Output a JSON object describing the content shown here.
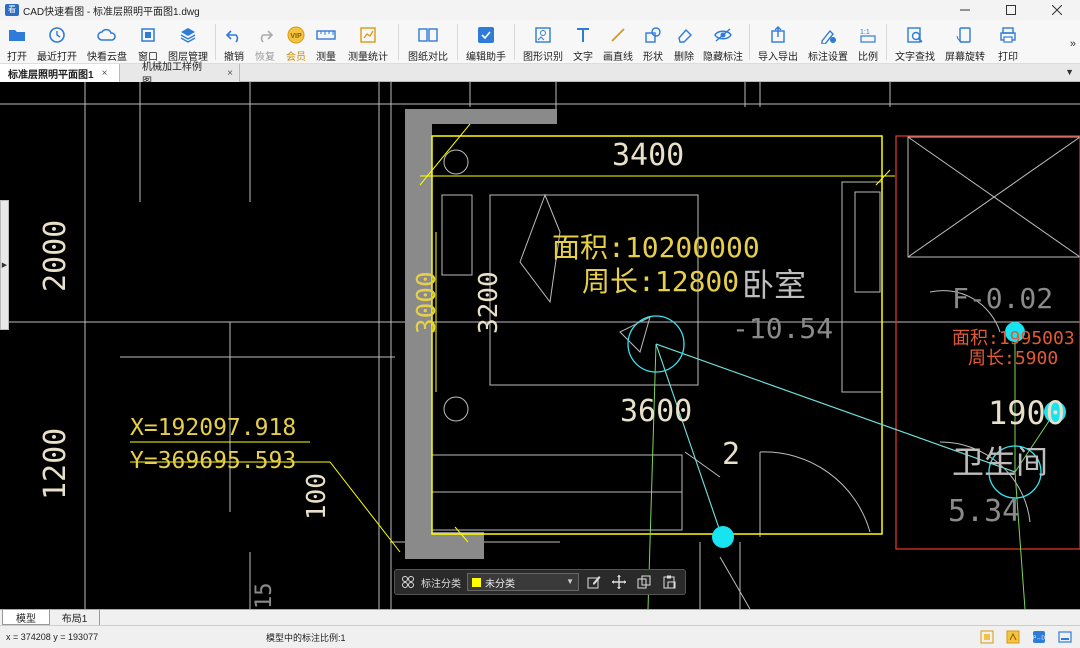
{
  "window": {
    "title": "CAD快速看图 - 标准层照明平面图1.dwg",
    "app_icon_text": "看",
    "controls": [
      "minimize-icon",
      "maximize-icon",
      "close-icon"
    ]
  },
  "toolbar": {
    "items": [
      {
        "id": "open",
        "label": "打开",
        "icon": "folder-icon"
      },
      {
        "id": "recent",
        "label": "最近打开",
        "icon": "clock-icon"
      },
      {
        "id": "cloud",
        "label": "快看云盘",
        "icon": "cloud-icon"
      },
      {
        "id": "window",
        "label": "窗口",
        "icon": "window-icon"
      },
      {
        "id": "layers",
        "label": "图层管理",
        "icon": "layers-icon"
      },
      {
        "id": "undo",
        "label": "撤销",
        "icon": "undo-icon"
      },
      {
        "id": "redo",
        "label": "恢复",
        "icon": "redo-icon",
        "disabled": true
      },
      {
        "id": "vip",
        "label": "会员",
        "icon": "vip-icon"
      },
      {
        "id": "measure",
        "label": "测量",
        "icon": "ruler-icon"
      },
      {
        "id": "measure-stats",
        "label": "测量统计",
        "icon": "stats-icon"
      },
      {
        "id": "compare",
        "label": "图纸对比",
        "icon": "compare-icon"
      },
      {
        "id": "edit-helper",
        "label": "编辑助手",
        "icon": "edit-helper-icon"
      },
      {
        "id": "shape-recog",
        "label": "图形识别",
        "icon": "shape-recog-icon"
      },
      {
        "id": "text",
        "label": "文字",
        "icon": "text-icon"
      },
      {
        "id": "line",
        "label": "画直线",
        "icon": "line-icon"
      },
      {
        "id": "shape",
        "label": "形状",
        "icon": "shape-icon"
      },
      {
        "id": "delete",
        "label": "删除",
        "icon": "eraser-icon"
      },
      {
        "id": "hide-annot",
        "label": "隐藏标注",
        "icon": "eye-hide-icon"
      },
      {
        "id": "import-export",
        "label": "导入导出",
        "icon": "export-icon"
      },
      {
        "id": "annot-settings",
        "label": "标注设置",
        "icon": "annot-settings-icon"
      },
      {
        "id": "scale",
        "label": "比例",
        "icon": "scale-icon"
      },
      {
        "id": "find-text",
        "label": "文字查找",
        "icon": "find-text-icon"
      },
      {
        "id": "rotate",
        "label": "屏幕旋转",
        "icon": "rotate-icon"
      },
      {
        "id": "print",
        "label": "打印",
        "icon": "printer-icon"
      }
    ],
    "more": "»"
  },
  "tabs": [
    {
      "label": "标准层照明平面图1",
      "active": true
    },
    {
      "label": "机械加工样例图",
      "active": false
    }
  ],
  "tab_close": "×",
  "tab_dropdown": "▼",
  "drawing": {
    "dim_top": "3400",
    "area": "面积:10200000",
    "perimeter": "周长:12800",
    "room": "卧室",
    "level": "-10.54",
    "dim_3000": "3000",
    "dim_3200": "3200",
    "dim_3600": "3600",
    "label_2": "2",
    "coord_x": "X=192097.918",
    "coord_y": "Y=369695.593",
    "left_2000": "2000",
    "left_1200": "1200",
    "dim_100": "100",
    "dim_15": "15",
    "right_dim_1900": "1900",
    "right_room": "卫生间",
    "right_level": "5.34",
    "right_area": "面积:1995003",
    "right_perimeter": "周长:5900",
    "right_f": "F-0.02"
  },
  "annotation_bar": {
    "label": "标注分类",
    "selected": "未分类",
    "swatch_color": "#ffff00"
  },
  "layout_tabs": {
    "model": "模型",
    "layout1": "布局1"
  },
  "status": {
    "coords": "x = 374208  y = 193077",
    "scale": "模型中的标注比例:1"
  }
}
